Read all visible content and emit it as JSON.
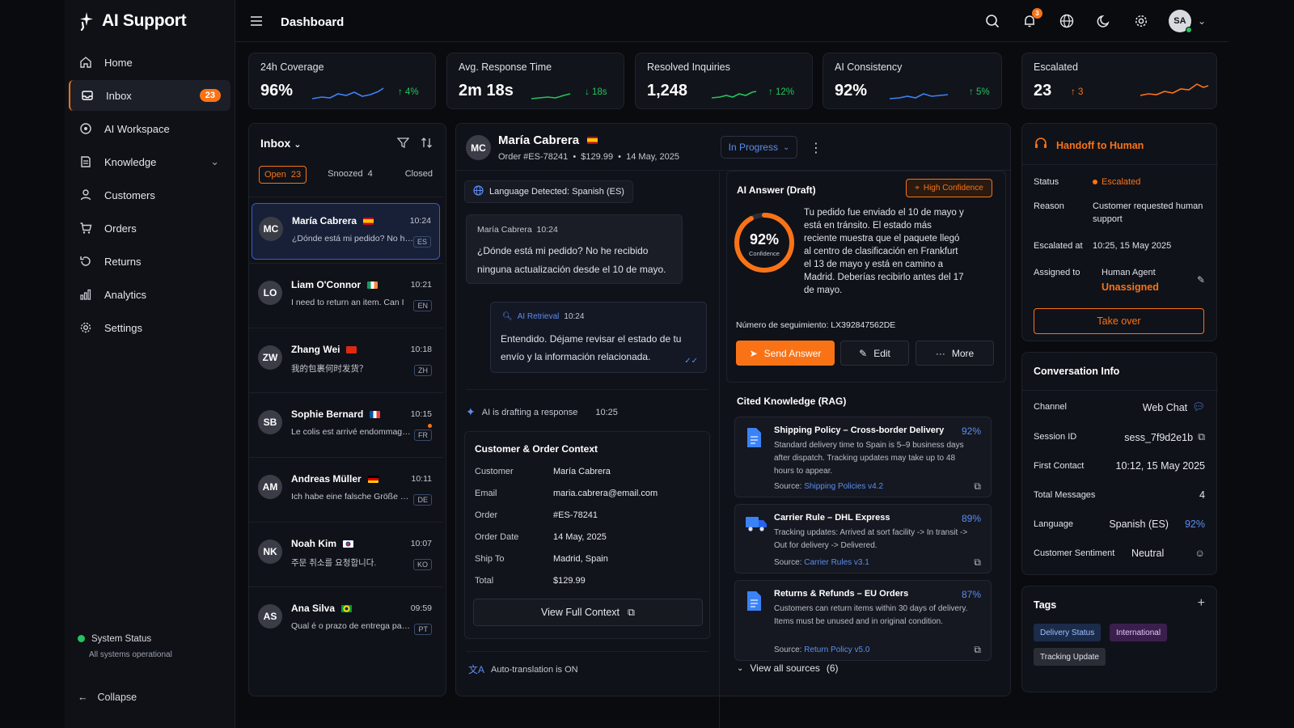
{
  "app": {
    "name": "AI Support"
  },
  "topbar": {
    "title": "Dashboard",
    "notifications": "3",
    "user_initials": "SA"
  },
  "nav": {
    "items": [
      {
        "label": "Home"
      },
      {
        "label": "Inbox",
        "badge": "23"
      },
      {
        "label": "AI Workspace"
      },
      {
        "label": "Knowledge"
      },
      {
        "label": "Customers"
      },
      {
        "label": "Orders"
      },
      {
        "label": "Returns"
      },
      {
        "label": "Analytics"
      },
      {
        "label": "Settings"
      }
    ],
    "system_status": "System Status",
    "system_status_detail": "All systems operational",
    "collapse": "Collapse"
  },
  "stats": [
    {
      "label": "24h Coverage",
      "value": "96%",
      "delta": "4%",
      "direction": "up"
    },
    {
      "label": "Avg. Response Time",
      "value": "2m 18s",
      "delta": "18s",
      "direction": "down"
    },
    {
      "label": "Resolved Inquiries",
      "value": "1,248",
      "delta": "12%",
      "direction": "up"
    },
    {
      "label": "AI Consistency",
      "value": "92%",
      "delta": "5%",
      "direction": "up"
    },
    {
      "label": "Escalated",
      "value": "23",
      "delta": "3",
      "direction": "up"
    }
  ],
  "inbox": {
    "title": "Inbox",
    "tabs": [
      {
        "label": "Open",
        "count": "23"
      },
      {
        "label": "Snoozed",
        "count": "4"
      },
      {
        "label": "Closed",
        "count": ""
      }
    ],
    "conversations": [
      {
        "initials": "MC",
        "name": "María Cabrera",
        "time": "10:24",
        "preview": "¿Dónde está mi pedido? No he recibido",
        "lang": "ES",
        "flag": "es"
      },
      {
        "initials": "LO",
        "name": "Liam O'Connor",
        "time": "10:21",
        "preview": "I need to return an item. Can I",
        "lang": "EN",
        "flag": "ie"
      },
      {
        "initials": "ZW",
        "name": "Zhang Wei",
        "time": "10:18",
        "preview": "我的包裹何时发货？",
        "lang": "ZH",
        "flag": "cn"
      },
      {
        "initials": "SB",
        "name": "Sophie Bernard",
        "time": "10:15",
        "preview": "Le colis est arrivé endommagé, que",
        "lang": "FR",
        "flag": "fr"
      },
      {
        "initials": "AM",
        "name": "Andreas Müller",
        "time": "10:11",
        "preview": "Ich habe eine falsche Größe erhalten",
        "lang": "DE",
        "flag": "de"
      },
      {
        "initials": "NK",
        "name": "Noah Kim",
        "time": "10:07",
        "preview": "주문 취소를 요청합니다.",
        "lang": "KO",
        "flag": "kr"
      },
      {
        "initials": "AS",
        "name": "Ana Silva",
        "time": "09:59",
        "preview": "Qual é o prazo de entrega para o Brasil?",
        "lang": "PT",
        "flag": "br"
      }
    ]
  },
  "conversation": {
    "initials": "MC",
    "name": "María Cabrera",
    "order": "Order #ES-78241",
    "amount": "$129.99",
    "date": "14 May, 2025",
    "status": "In Progress",
    "language_detected": "Language Detected: Spanish (ES)",
    "user_msg": {
      "who": "María Cabrera",
      "time": "10:24",
      "text": "¿Dónde está mi pedido? No he recibido ninguna actualización desde el 10 de mayo."
    },
    "ai_msg": {
      "who": "AI Retrieval",
      "time": "10:24",
      "text": "Entendido. Déjame revisar el estado de tu envío y la información relacionada."
    },
    "drafting": "AI is drafting a response",
    "drafting_time": "10:25",
    "context": {
      "title": "Customer & Order Context",
      "rows": [
        {
          "k": "Customer",
          "v": "María Cabrera"
        },
        {
          "k": "Email",
          "v": "maria.cabrera@email.com"
        },
        {
          "k": "Order",
          "v": "#ES-78241"
        },
        {
          "k": "Order Date",
          "v": "14 May, 2025"
        },
        {
          "k": "Ship To",
          "v": "Madrid, Spain"
        },
        {
          "k": "Total",
          "v": "$129.99"
        }
      ],
      "button": "View Full Context"
    },
    "autotranslate": "Auto-translation is ON"
  },
  "answer": {
    "title": "AI Answer (Draft)",
    "confidence_badge": "High Confidence",
    "confidence": "92%",
    "confidence_value": 0.92,
    "confidence_label": "Confidence",
    "text": "Tu pedido fue enviado el 10 de mayo y está en tránsito. El estado más reciente muestra que el paquete llegó al centro de clasificación en Frankfurt el 13 de mayo y está en camino a Madrid. Deberías recibirlo antes del 17 de mayo.",
    "tracking": "Número de seguimiento: LX392847562DE",
    "send": "Send Answer",
    "edit": "Edit",
    "more": "More"
  },
  "cited": {
    "title": "Cited Knowledge (RAG)",
    "items": [
      {
        "title": "Shipping Policy – Cross-border Delivery",
        "pct": "92%",
        "desc": "Standard delivery time to Spain is 5–9 business days after dispatch. Tracking updates may take up to 48 hours to appear.",
        "source_prefix": "Source:",
        "source": "Shipping Policies v4.2"
      },
      {
        "title": "Carrier Rule – DHL Express",
        "pct": "89%",
        "desc": "Tracking updates: Arrived at sort facility -> In transit -> Out for delivery -> Delivered.",
        "source_prefix": "Source:",
        "source": "Carrier Rules v3.1"
      },
      {
        "title": "Returns & Refunds – EU Orders",
        "pct": "87%",
        "desc": "Customers can return items within 30 days of delivery. Items must be unused and in original condition.",
        "source_prefix": "Source:",
        "source": "Return Policy v5.0"
      }
    ],
    "view_all": "View all sources",
    "view_all_count": "(6)"
  },
  "handoff": {
    "title": "Handoff to Human",
    "rows": [
      {
        "k": "Status",
        "v": "Escalated"
      },
      {
        "k": "Reason",
        "v": "Customer requested human support"
      },
      {
        "k": "Escalated at",
        "v": "10:25, 15 May 2025"
      },
      {
        "k": "Assigned to",
        "v": "Human Agent"
      }
    ],
    "assignee_status": "Unassigned",
    "take_over": "Take over"
  },
  "conv_info": {
    "title": "Conversation Info",
    "rows": [
      {
        "k": "Channel",
        "v": "Web Chat"
      },
      {
        "k": "Session ID",
        "v": "sess_7f9d2e1b"
      },
      {
        "k": "First Contact",
        "v": "10:12, 15 May 2025"
      },
      {
        "k": "Total Messages",
        "v": "4"
      },
      {
        "k": "Language",
        "v": "Spanish (ES)",
        "extra": "92%"
      },
      {
        "k": "Customer Sentiment",
        "v": "Neutral"
      }
    ]
  },
  "tags": {
    "title": "Tags",
    "items": [
      "Delivery Status",
      "International",
      "Tracking Update"
    ]
  },
  "colors": {
    "accent": "#f97316",
    "primary_blue": "#3b82f6",
    "positive": "#22c55e",
    "bg": "#0a0b0f"
  }
}
